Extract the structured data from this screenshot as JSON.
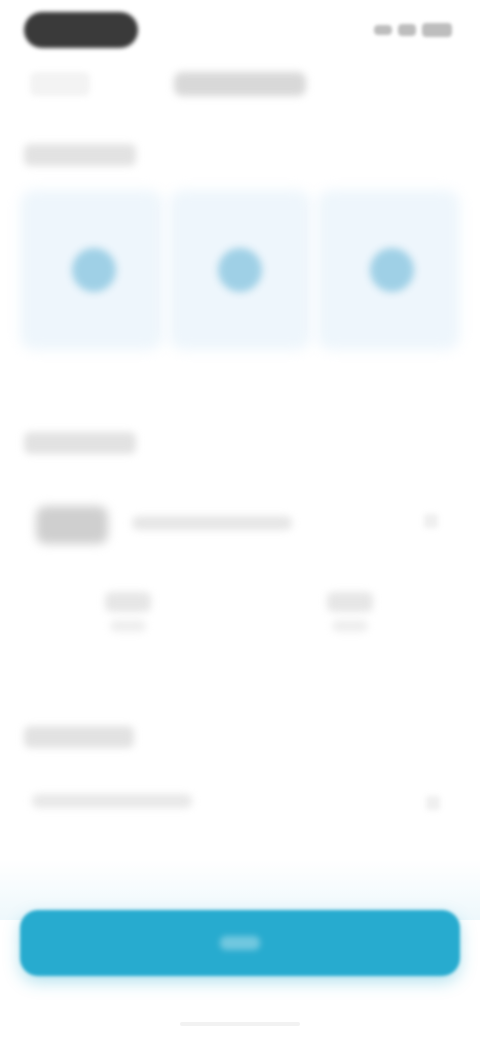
{
  "status_bar": {
    "icons": [
      "signal-icon",
      "wifi-icon",
      "battery-icon"
    ]
  },
  "header": {
    "back_label": "",
    "title": ""
  },
  "sections": {
    "options_title": "",
    "item_title": "",
    "select_title": ""
  },
  "options": [
    {
      "label": "",
      "icon": "option-icon"
    },
    {
      "label": "",
      "icon": "option-icon"
    },
    {
      "label": "",
      "icon": "option-icon"
    }
  ],
  "item": {
    "name": "",
    "stats": [
      {
        "value": "",
        "sub": ""
      },
      {
        "value": "",
        "sub": ""
      }
    ]
  },
  "select": {
    "value": ""
  },
  "cta": {
    "label": ""
  },
  "colors": {
    "accent": "#27abcf",
    "option_bg": "#eef6fc",
    "option_dot": "#9fd0e6",
    "camera_pill": "#3a3a3a"
  }
}
